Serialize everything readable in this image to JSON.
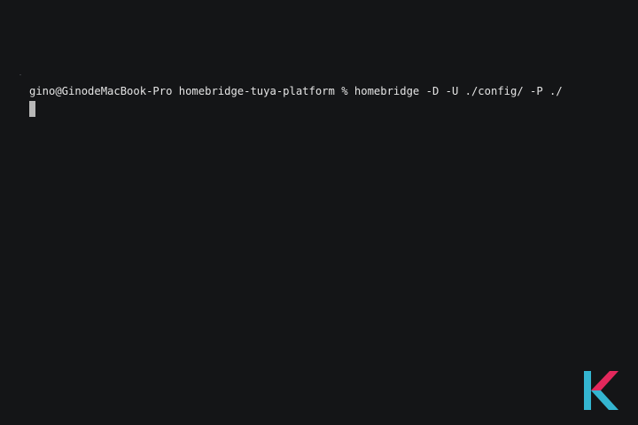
{
  "terminal": {
    "prompt": "gino@GinodeMacBook-Pro homebridge-tuya-platform %",
    "command": "homebridge -D -U ./config/ -P ./"
  },
  "watermark": {
    "logo_text": "K",
    "colors": {
      "teal": "#34b5d1",
      "pink": "#e3285c"
    }
  },
  "theme": {
    "background": "#141517",
    "text": "#e4e4e4",
    "cursor": "#b8b8b8"
  }
}
